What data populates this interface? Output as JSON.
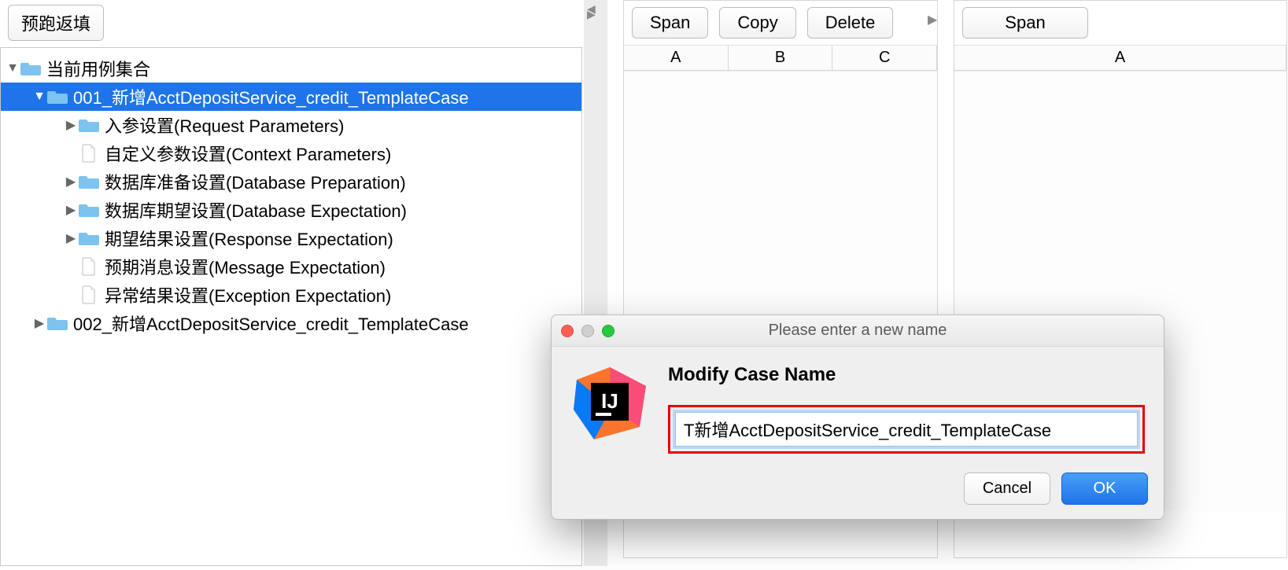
{
  "toolbar": {
    "prejump_label": "预跑返填"
  },
  "tree": {
    "root_label": "当前用例集合",
    "items": [
      {
        "label": "001_新增AcctDepositService_credit_TemplateCase",
        "children": [
          {
            "label": "入参设置(Request Parameters)",
            "type": "folder",
            "expandable": true
          },
          {
            "label": "自定义参数设置(Context Parameters)",
            "type": "file",
            "expandable": false
          },
          {
            "label": "数据库准备设置(Database Preparation)",
            "type": "folder",
            "expandable": true
          },
          {
            "label": "数据库期望设置(Database Expectation)",
            "type": "folder",
            "expandable": true
          },
          {
            "label": "期望结果设置(Response Expectation)",
            "type": "folder",
            "expandable": true
          },
          {
            "label": "预期消息设置(Message Expectation)",
            "type": "file",
            "expandable": false
          },
          {
            "label": "异常结果设置(Exception Expectation)",
            "type": "file",
            "expandable": false
          }
        ]
      },
      {
        "label": "002_新增AcctDepositService_credit_TemplateCase"
      }
    ]
  },
  "right": {
    "pane1": {
      "buttons": [
        "Span",
        "Copy",
        "Delete"
      ],
      "cols": [
        "A",
        "B",
        "C"
      ]
    },
    "pane2": {
      "buttons": [
        "Span"
      ],
      "cols": [
        "A"
      ]
    }
  },
  "dialog": {
    "title": "Please enter a new name",
    "heading": "Modify Case Name",
    "input_value": "T新增AcctDepositService_credit_TemplateCase",
    "cancel": "Cancel",
    "ok": "OK"
  }
}
